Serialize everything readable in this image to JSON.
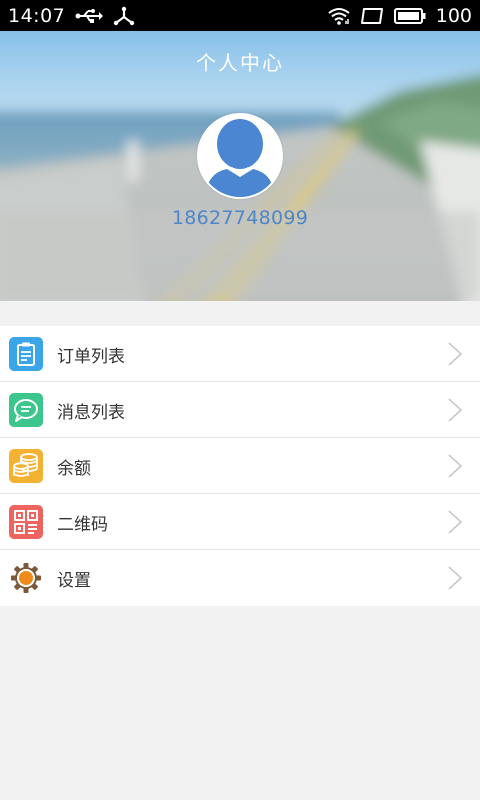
{
  "status_bar": {
    "time": "14:07",
    "battery_level": "100",
    "icons": [
      "usb-icon",
      "usb-debug-icon",
      "wifi-icon",
      "screen-icon",
      "battery-icon"
    ]
  },
  "header": {
    "title": "个人中心",
    "phone": "18627748099"
  },
  "menu": {
    "items": [
      {
        "label": "订单列表",
        "icon": "order-list-icon",
        "color": "#3aa6e8"
      },
      {
        "label": "消息列表",
        "icon": "message-list-icon",
        "color": "#3cc58d"
      },
      {
        "label": "余额",
        "icon": "balance-icon",
        "color": "#f4b233"
      },
      {
        "label": "二维码",
        "icon": "qrcode-icon",
        "color": "#f0645f"
      },
      {
        "label": "设置",
        "icon": "settings-icon",
        "color": "#f08a1c"
      }
    ]
  },
  "colors": {
    "accent_blue": "#4d86c9",
    "background": "#f2f2f2"
  }
}
